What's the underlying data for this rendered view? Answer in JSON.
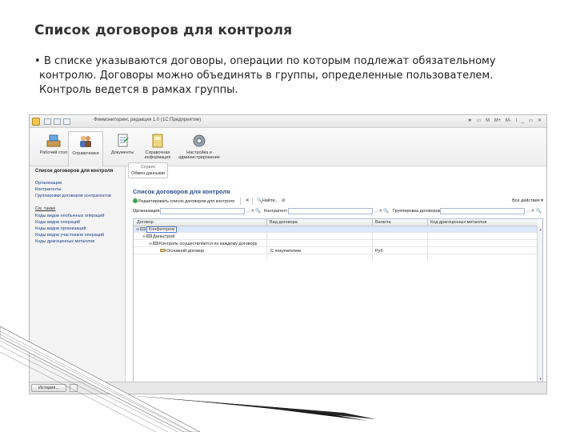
{
  "slide": {
    "title": "Список договоров для контроля",
    "bullet": "В списке указываются договоры, операции по которым подлежат обязательному контролю. Договоры можно объединять в группы, определенные пользователем. Контроль ведется в рамках группы."
  },
  "window": {
    "title": "Финмониторинг, редакция 1.0  (1С:Предприятие)",
    "controls": [
      "★",
      "▭",
      "M",
      "M+",
      "M-",
      "i",
      "_",
      "▭",
      "✕"
    ]
  },
  "ribbon": [
    {
      "label": "Рабочий стол",
      "icon": "desktop-icon"
    },
    {
      "label": "Справочники",
      "icon": "users-icon"
    },
    {
      "label": "Документы",
      "icon": "documents-icon"
    },
    {
      "label": "Справочная информация",
      "icon": "book-icon"
    },
    {
      "label": "Настройка и администрирование",
      "icon": "gear-icon"
    }
  ],
  "sidebar": {
    "heading": "Список договоров для контроля",
    "items": [
      "Организации",
      "Контрагенты",
      "Группировки договоров контрагентов"
    ],
    "section": "См. также",
    "items2": [
      "Коды видов необычных операций",
      "Коды видов операций",
      "Коды видов организаций",
      "Коды видов участников операций",
      "Коды драгоценных металлов"
    ]
  },
  "service": {
    "line1": "Сервис",
    "line2": "Обмен данными"
  },
  "form": {
    "title": "Список договоров для контроля",
    "toolbar": {
      "edit": "Редактировать список договоров для контроля",
      "find": "Найти...",
      "all_actions": "Все действия ▾"
    },
    "filters": {
      "org": "Организация:",
      "counterparty": "Контрагент:",
      "grouping": "Группировка договоров:"
    },
    "columns": [
      "Договор",
      "Вид договора",
      "Валюта",
      "Код драгоценных металлов"
    ],
    "rows": [
      {
        "name": "Конфетпром",
        "kind": "",
        "currency": "",
        "code": ""
      },
      {
        "name": "Дальстрой",
        "kind": "",
        "currency": "",
        "code": ""
      },
      {
        "name": "Контроль осуществляется по каждому договору",
        "kind": "",
        "currency": "",
        "code": ""
      },
      {
        "name": "Основной договор",
        "kind": "С покупателем",
        "currency": "Руб",
        "code": ""
      }
    ]
  },
  "status": {
    "history": "История..."
  }
}
